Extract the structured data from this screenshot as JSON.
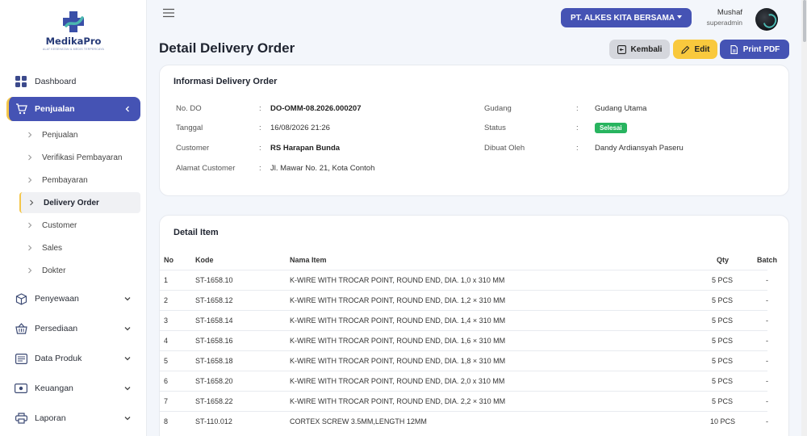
{
  "app": {
    "logo_text": "MedikaPro",
    "logo_tagline": "ALAT KESEHATAN & MEDIS TERPERCAYA"
  },
  "sidebar": {
    "items": [
      {
        "label": "Dashboard",
        "icon": "grid-icon"
      },
      {
        "label": "Penjualan",
        "icon": "cart-icon",
        "active": true
      },
      {
        "label": "Penyewaan",
        "icon": "box-icon"
      },
      {
        "label": "Persediaan",
        "icon": "basket-icon"
      },
      {
        "label": "Data Produk",
        "icon": "list-icon"
      },
      {
        "label": "Keuangan",
        "icon": "money-icon"
      },
      {
        "label": "Laporan",
        "icon": "printer-icon"
      }
    ],
    "sub_items": [
      {
        "label": "Penjualan"
      },
      {
        "label": "Verifikasi Pembayaran"
      },
      {
        "label": "Pembayaran"
      },
      {
        "label": "Delivery Order",
        "active": true
      },
      {
        "label": "Customer"
      },
      {
        "label": "Sales"
      },
      {
        "label": "Dokter"
      }
    ]
  },
  "topbar": {
    "company": "PT. ALKES KITA BERSAMA",
    "user_name": "Mushaf",
    "user_role": "superadmin"
  },
  "page": {
    "title": "Detail Delivery Order",
    "back_label": "Kembali",
    "edit_label": "Edit",
    "print_label": "Print PDF"
  },
  "info": {
    "title": "Informasi Delivery Order",
    "colon": ":",
    "no_do_label": "No. DO",
    "no_do": "DO-OMM-08.2026.000207",
    "tanggal_label": "Tanggal",
    "tanggal": "16/08/2026 21:26",
    "customer_label": "Customer",
    "customer": "RS Harapan Bunda",
    "alamat_label": "Alamat Customer",
    "alamat": "Jl. Mawar No. 21, Kota Contoh",
    "gudang_label": "Gudang",
    "gudang": "Gudang Utama",
    "status_label": "Status",
    "status": "Selesai",
    "dibuat_label": "Dibuat Oleh",
    "dibuat": "Dandy Ardiansyah Paseru"
  },
  "items": {
    "title": "Detail Item",
    "headers": {
      "no": "No",
      "kode": "Kode",
      "nama": "Nama Item",
      "qty": "Qty",
      "batch": "Batch"
    },
    "rows": [
      {
        "no": "1",
        "kode": "ST-1658.10",
        "nama": "K-WIRE WITH TROCAR POINT, ROUND END, DIA. 1,0 x 310 MM",
        "qty": "5 PCS",
        "batch": "-"
      },
      {
        "no": "2",
        "kode": "ST-1658.12",
        "nama": "K-WIRE WITH TROCAR POINT, ROUND END, DIA. 1,2 × 310 MM",
        "qty": "5 PCS",
        "batch": "-"
      },
      {
        "no": "3",
        "kode": "ST-1658.14",
        "nama": "K-WIRE WITH TROCAR POINT, ROUND END, DIA. 1,4 × 310 MM",
        "qty": "5 PCS",
        "batch": "-"
      },
      {
        "no": "4",
        "kode": "ST-1658.16",
        "nama": "K-WIRE WITH TROCAR POINT, ROUND END, DIA. 1,6 × 310 MM",
        "qty": "5 PCS",
        "batch": "-"
      },
      {
        "no": "5",
        "kode": "ST-1658.18",
        "nama": "K-WIRE WITH TROCAR POINT, ROUND END, DIA. 1,8 × 310 MM",
        "qty": "5 PCS",
        "batch": "-"
      },
      {
        "no": "6",
        "kode": "ST-1658.20",
        "nama": "K-WIRE WITH TROCAR POINT, ROUND END, DIA. 2,0 x 310 MM",
        "qty": "5 PCS",
        "batch": "-"
      },
      {
        "no": "7",
        "kode": "ST-1658.22",
        "nama": "K-WIRE WITH TROCAR POINT, ROUND END, DIA. 2,2 × 310 MM",
        "qty": "5 PCS",
        "batch": "-"
      },
      {
        "no": "8",
        "kode": "ST-110.012",
        "nama": "CORTEX SCREW 3.5MM,LENGTH 12MM",
        "qty": "10 PCS",
        "batch": "-"
      }
    ]
  },
  "colors": {
    "primary": "#4553b4",
    "accent": "#f9c93d",
    "success": "#28b45f"
  }
}
